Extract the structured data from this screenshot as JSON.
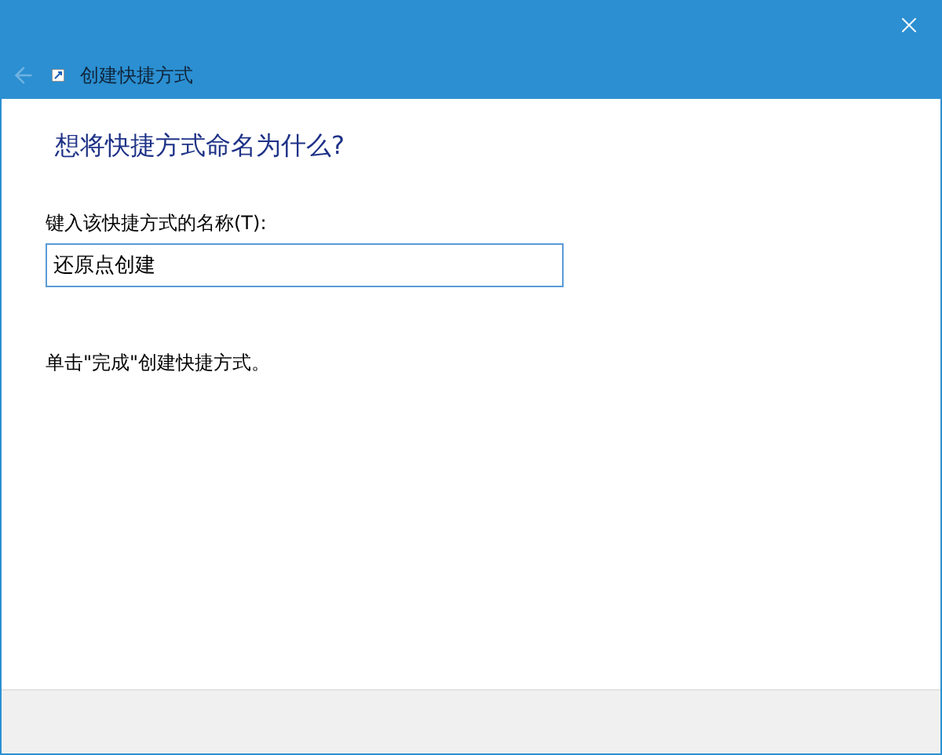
{
  "window": {
    "title": "创建快捷方式",
    "back_disabled": true
  },
  "heading": "想将快捷方式命名为什么?",
  "name_field": {
    "label": "键入该快捷方式的名称(T):",
    "value": "还原点创建"
  },
  "hint": "单击\"完成\"创建快捷方式。"
}
